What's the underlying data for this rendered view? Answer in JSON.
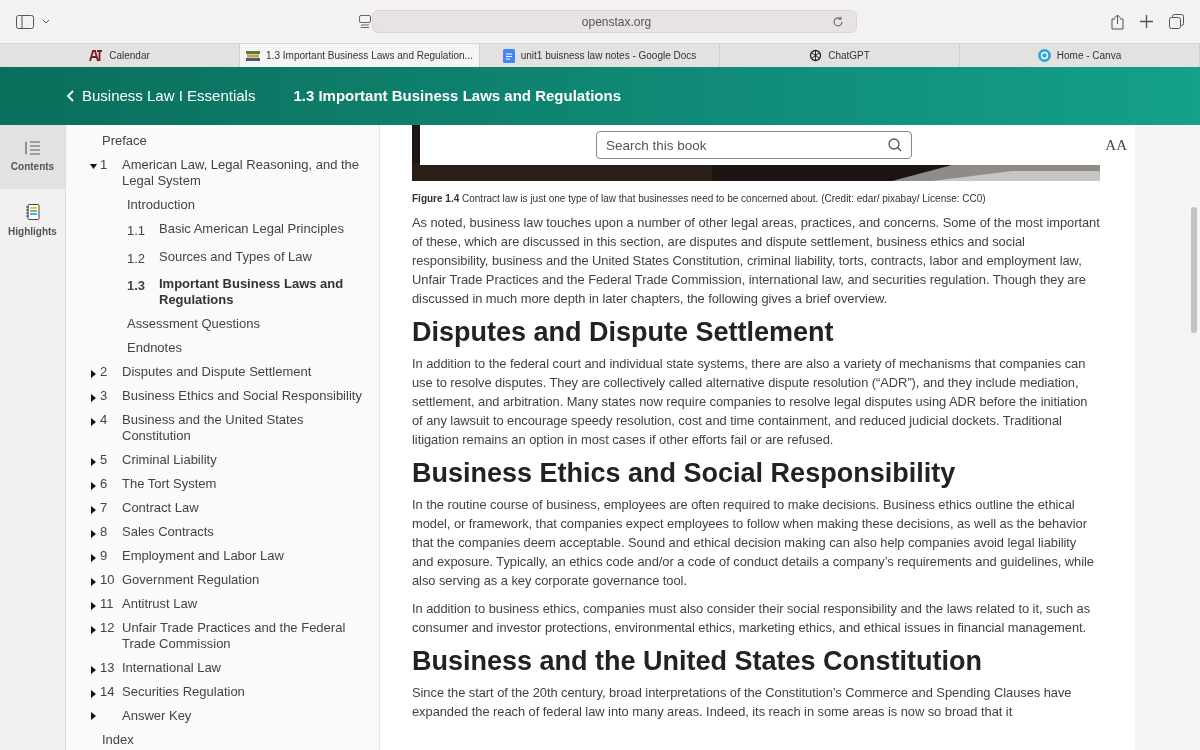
{
  "browser": {
    "address": "openstax.org",
    "tabs": [
      {
        "label": "Calendar",
        "selected": false
      },
      {
        "label": "1.3 Important Business Laws and Regulation...",
        "selected": true
      },
      {
        "label": "unit1 buisness law notes - Google Docs",
        "selected": false
      },
      {
        "label": "ChatGPT",
        "selected": false
      },
      {
        "label": "Home - Canva",
        "selected": false
      }
    ]
  },
  "header": {
    "back_label": "Business Law I Essentials",
    "title": "1.3 Important Business Laws and Regulations"
  },
  "rail": [
    {
      "label": "Contents",
      "selected": true
    },
    {
      "label": "Highlights",
      "selected": false
    }
  ],
  "toc": [
    {
      "kind": "page",
      "label": "Preface",
      "selected": false
    },
    {
      "kind": "chapter",
      "number": "1",
      "label": "American Law, Legal Reasoning, and the Legal System",
      "expanded": true,
      "children": [
        {
          "kind": "page",
          "label": "Introduction",
          "selected": false
        },
        {
          "kind": "page",
          "number": "1.1",
          "label": "Basic American Legal Principles",
          "selected": false
        },
        {
          "kind": "page",
          "number": "1.2",
          "label": "Sources and Types of Law",
          "selected": false
        },
        {
          "kind": "page",
          "number": "1.3",
          "label": "Important Business Laws and Regulations",
          "selected": true
        },
        {
          "kind": "page",
          "label": "Assessment Questions",
          "selected": false
        },
        {
          "kind": "page",
          "label": "Endnotes",
          "selected": false
        }
      ]
    },
    {
      "kind": "chapter",
      "number": "2",
      "label": "Disputes and Dispute Settlement",
      "expanded": false
    },
    {
      "kind": "chapter",
      "number": "3",
      "label": "Business Ethics and Social Responsibility",
      "expanded": false
    },
    {
      "kind": "chapter",
      "number": "4",
      "label": "Business and the United States Constitution",
      "expanded": false
    },
    {
      "kind": "chapter",
      "number": "5",
      "label": "Criminal Liability",
      "expanded": false
    },
    {
      "kind": "chapter",
      "number": "6",
      "label": "The Tort System",
      "expanded": false
    },
    {
      "kind": "chapter",
      "number": "7",
      "label": "Contract Law",
      "expanded": false
    },
    {
      "kind": "chapter",
      "number": "8",
      "label": "Sales Contracts",
      "expanded": false
    },
    {
      "kind": "chapter",
      "number": "9",
      "label": "Employment and Labor Law",
      "expanded": false
    },
    {
      "kind": "chapter",
      "number": "10",
      "label": "Government Regulation",
      "expanded": false
    },
    {
      "kind": "chapter",
      "number": "11",
      "label": "Antitrust Law",
      "expanded": false
    },
    {
      "kind": "chapter",
      "number": "12",
      "label": "Unfair Trade Practices and the Federal Trade Commission",
      "expanded": false
    },
    {
      "kind": "chapter",
      "number": "13",
      "label": "International Law",
      "expanded": false
    },
    {
      "kind": "chapter",
      "number": "14",
      "label": "Securities Regulation",
      "expanded": false
    },
    {
      "kind": "chapter",
      "label": "Answer Key",
      "expanded": false
    },
    {
      "kind": "page",
      "label": "Index",
      "selected": false
    }
  ],
  "search": {
    "placeholder": "Search this book",
    "font_button": "AA"
  },
  "content": [
    {
      "kind": "figure"
    },
    {
      "kind": "caption",
      "text": "**Figure 1.4** Contract law is just one type of law that businesses need to be concerned about. (Credit: edar/ pixabay/ License: CC0)"
    },
    {
      "kind": "paragraph",
      "text": "As noted, business law touches upon a number of other legal areas, practices, and concerns. Some of the most important of these, which are discussed in this section, are disputes and dispute settlement, business ethics and social responsibility, business and the United States Constitution, criminal liability, torts, contracts, labor and employment law, Unfair Trade Practices and the Federal Trade Commission, international law, and securities regulation. Though they are discussed in much more depth in later chapters, the following gives a brief overview."
    },
    {
      "kind": "heading",
      "text": "Disputes and Dispute Settlement"
    },
    {
      "kind": "paragraph",
      "text": "In addition to the federal court and individual state systems, there are also a variety of mechanisms that companies can use to resolve disputes. They are collectively called alternative dispute resolution (“ADR”), and they include mediation, settlement, and arbitration. Many states now require companies to resolve legal disputes using ADR before the initiation of any lawsuit to encourage speedy resolution, cost and time containment, and reduced judicial dockets. Traditional litigation remains an option in most cases if other efforts fail or are refused."
    },
    {
      "kind": "heading",
      "text": "Business Ethics and Social Responsibility"
    },
    {
      "kind": "paragraph",
      "text": "In the routine course of business, employees are often required to make decisions. Business ethics outline the ethical model, or framework, that companies expect employees to follow when making these decisions, as well as the behavior that the companies deem acceptable. Sound and ethical decision making can also help companies avoid legal liability and exposure. Typically, an ethics code and/or a code of conduct details a company’s requirements and guidelines, while also serving as a key corporate governance tool."
    },
    {
      "kind": "paragraph",
      "text": "In addition to business ethics, companies must also consider their social responsibility and the laws related to it, such as consumer and investor protections, environmental ethics, marketing ethics, and ethical issues in financial management."
    },
    {
      "kind": "heading",
      "text": "Business and the United States Constitution"
    },
    {
      "kind": "paragraph",
      "text": "Since the start of the 20th century, broad interpretations of the Constitution’s Commerce and Spending Clauses have expanded the reach of federal law into many areas. Indeed, its reach in some areas is now so broad that it"
    }
  ]
}
